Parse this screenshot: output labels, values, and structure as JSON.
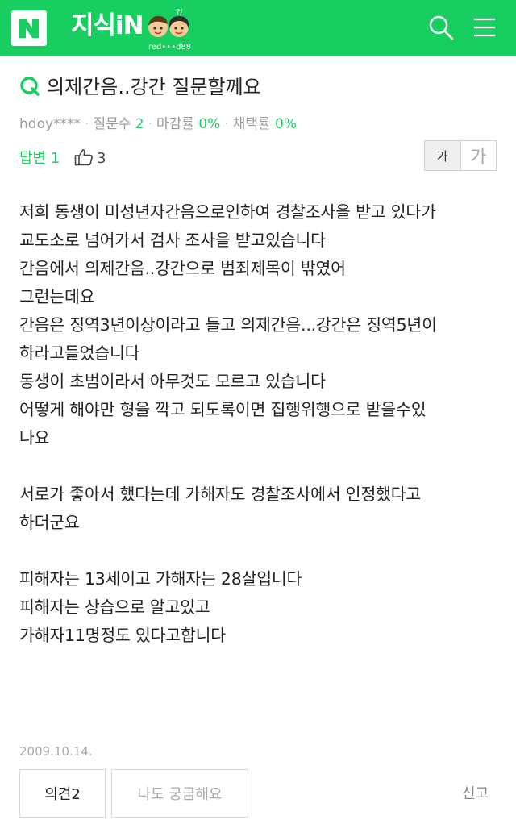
{
  "header": {
    "logo_letter": "N",
    "brand": "지식iN",
    "mascot_caption": "red•••d88",
    "colors": {
      "brand_green": "#19ce60",
      "text_white": "#ffffff"
    },
    "icons": [
      "search-icon",
      "menu-icon"
    ]
  },
  "question": {
    "q_mark": "Q",
    "title": "의제간음..강간 질문할께요",
    "author": "hdoy****",
    "stats": [
      {
        "label": "질문수",
        "value": "2"
      },
      {
        "label": "마감률",
        "value": "0%"
      },
      {
        "label": "채택률",
        "value": "0%"
      }
    ],
    "answer_label": "답변 1",
    "like_count": "3",
    "font_small_label": "가",
    "font_large_label": "가",
    "body": [
      [
        "저희 동생이 미성년자간음으로인하여 경찰조사을 받고 있다가",
        "교도소로 넘어가서 검사 조사을 받고있습니다",
        "간음에서 의제간음..강간으로 범죄제목이 밖였어",
        "그런는데요",
        "간음은 징역3년이상이라고 들고 의제간음...강간은 징역5년이",
        "하라고들었습니다",
        "동생이 초범이라서 아무것도 모르고 있습니다",
        "어떻게 해야만 형을 깍고 되도록이면 집행위행으로 받을수있",
        "나요"
      ],
      [
        "서로가 좋아서 했다는데  가해자도 경찰조사에서 인정했다고",
        "하더군요"
      ],
      [
        "피해자는 13세이고 가해자는 28살입니다",
        "피해자는 상습으로 알고있고",
        "가해자11명정도 있다고합니다"
      ]
    ],
    "date": "2009.10.14."
  },
  "actions": {
    "opinion": "의견2",
    "curious": "나도 궁금해요",
    "report": "신고"
  }
}
